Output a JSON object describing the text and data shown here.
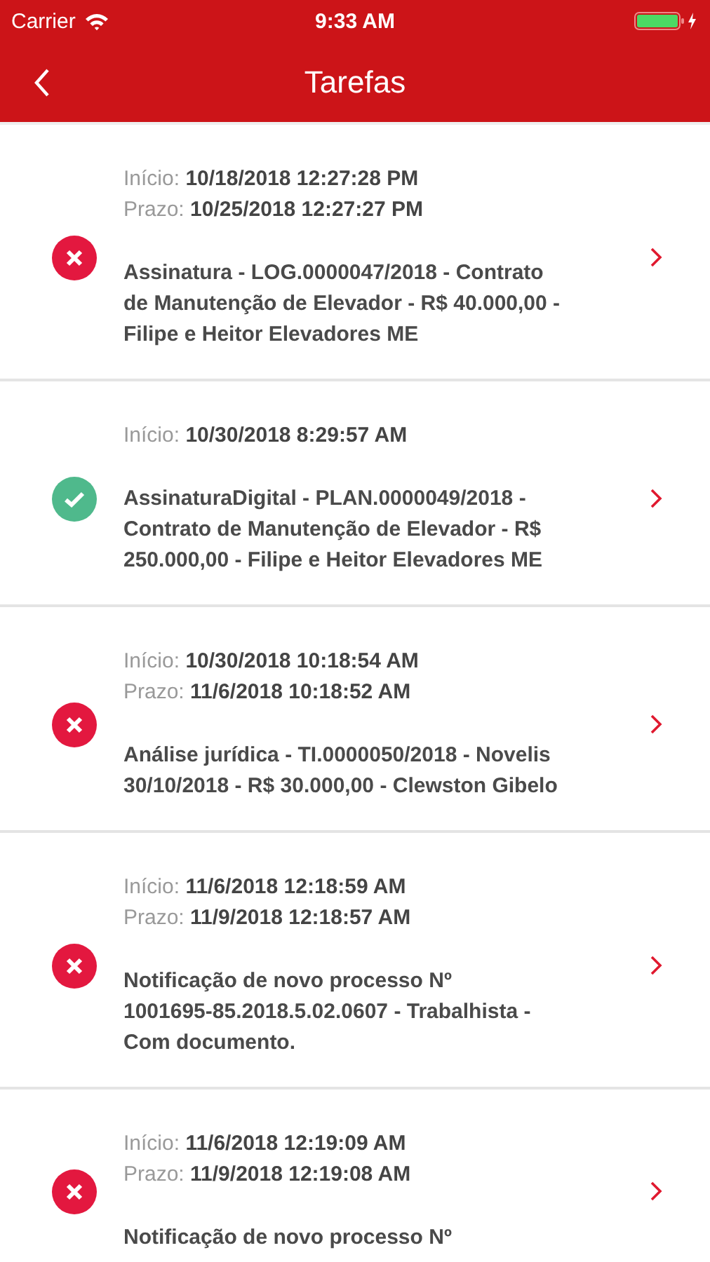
{
  "status_bar": {
    "carrier": "Carrier",
    "time": "9:33 AM"
  },
  "nav": {
    "title": "Tarefas"
  },
  "tasks": [
    {
      "kind": "error",
      "dates": [
        "Início: **10/18/2018 12:27:28 PM**",
        "Prazo: **10/25/2018 12:27:27 PM**"
      ],
      "title": "Assinatura - LOG.0000047/2018 - Contrato de Manutenção de Elevador - R$ 40.000,00 - Filipe e Heitor Elevadores ME"
    },
    {
      "kind": "done",
      "dates": [
        "Início: **10/30/2018 8:29:57 AM**"
      ],
      "title": "AssinaturaDigital - PLAN.0000049/2018 - Contrato de Manutenção de Elevador - R$ 250.000,00 - Filipe e Heitor Elevadores ME"
    },
    {
      "kind": "error",
      "dates": [
        "Início: **10/30/2018 10:18:54 AM**",
        "Prazo: **11/6/2018 10:18:52 AM**"
      ],
      "title": "Análise jurídica - TI.0000050/2018 - Novelis 30/10/2018 - R$ 30.000,00 - Clewston Gibelo"
    },
    {
      "kind": "error",
      "dates": [
        "Início: **11/6/2018 12:18:59 AM**",
        "Prazo: **11/9/2018 12:18:57 AM**"
      ],
      "title": "Notificação de novo processo Nº 1001695-85.2018.5.02.0607 - Trabalhista - Com documento."
    },
    {
      "kind": "error",
      "dates": [
        "Início: **11/6/2018 12:19:09 AM**",
        "Prazo: **11/9/2018 12:19:08 AM**"
      ],
      "title": "Notificação de novo processo Nº"
    }
  ]
}
